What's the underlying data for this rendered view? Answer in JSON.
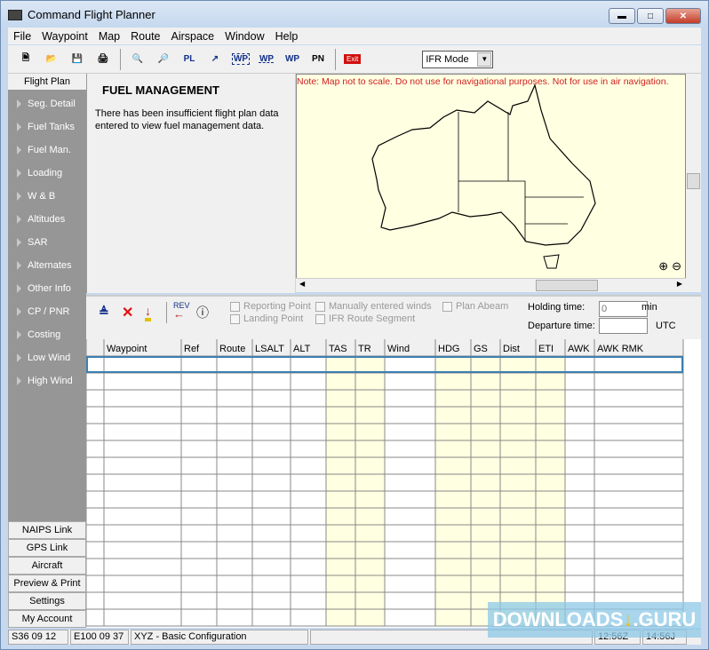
{
  "title": "Command Flight Planner",
  "menu": [
    "File",
    "Waypoint",
    "Map",
    "Route",
    "Airspace",
    "Window",
    "Help"
  ],
  "toolbar": {
    "mode": "IFR Mode",
    "exit": "Exit",
    "wp1": "WP",
    "wp2": "WP",
    "wp3": "WP",
    "pn": "PN",
    "pl": "PL"
  },
  "sidebar": {
    "tab": "Flight Plan",
    "items": [
      "Seg. Detail",
      "Fuel Tanks",
      "Fuel Man.",
      "Loading",
      "W & B",
      "Altitudes",
      "SAR",
      "Alternates",
      "Other Info",
      "CP / PNR",
      "Costing",
      "Low Wind",
      "High Wind"
    ],
    "buttons": [
      "NAIPS Link",
      "GPS Link",
      "Aircraft",
      "Preview & Print",
      "Settings",
      "My Account"
    ]
  },
  "fuel": {
    "heading": "FUEL MANAGEMENT",
    "message": "There has been insufficient flight plan data entered to view fuel management data."
  },
  "map": {
    "note": "Note: Map not to scale.  Do not use for navigational purposes. Not for use in air navigation."
  },
  "options": {
    "reporting_point": "Reporting Point",
    "manual_winds": "Manually entered winds",
    "plan_abeam": "Plan Abeam",
    "landing_point": "Landing Point",
    "ifr_segment": "IFR Route Segment",
    "holding_label": "Holding time:",
    "holding_value": "0",
    "holding_unit": "min",
    "departure_label": "Departure time:",
    "departure_value": "",
    "departure_unit": "UTC",
    "rev": "REV"
  },
  "table": {
    "columns": [
      "Waypoint",
      "Ref",
      "Route",
      "LSALT",
      "ALT",
      "TAS",
      "TR",
      "Wind",
      "HDG",
      "GS",
      "Dist",
      "ETI",
      "AWK",
      "AWK RMK"
    ],
    "highlight": [
      "TAS",
      "TR",
      "HDG",
      "GS",
      "Dist",
      "ETI"
    ],
    "rows": 16
  },
  "status": {
    "lat": "S36 09 12",
    "lon": "E100 09 37",
    "config": "XYZ - Basic Configuration",
    "blank": "",
    "utc": "12:56Z",
    "local": "14:56J"
  },
  "watermark": "DOWNLOADS↓.GURU",
  "colors": {
    "highlight": "#ffffe1",
    "note": "#d02020",
    "sidebar": "#969696"
  }
}
